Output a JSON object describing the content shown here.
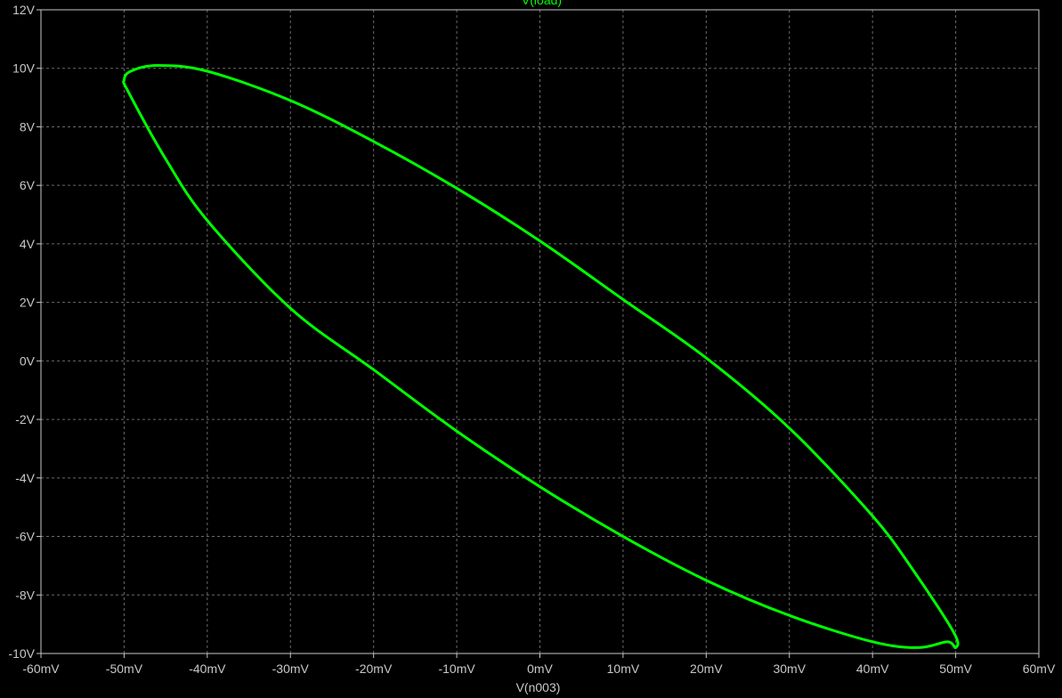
{
  "chart_data": {
    "type": "line",
    "title": "V(load)",
    "xlabel": "V(n003)",
    "ylabel": "",
    "xlim": [
      -60,
      60
    ],
    "ylim": [
      -10,
      12
    ],
    "x_unit": "mV",
    "y_unit": "V",
    "x_ticks": [
      -60,
      -50,
      -40,
      -30,
      -20,
      -10,
      0,
      10,
      20,
      30,
      40,
      50,
      60
    ],
    "y_ticks": [
      -10,
      -8,
      -6,
      -4,
      -2,
      0,
      2,
      4,
      6,
      8,
      10,
      12
    ],
    "x_tick_labels": [
      "-60mV",
      "-50mV",
      "-40mV",
      "-30mV",
      "-20mV",
      "-10mV",
      "0mV",
      "10mV",
      "20mV",
      "30mV",
      "40mV",
      "50mV",
      "60mV"
    ],
    "y_tick_labels": [
      "-10V",
      "-8V",
      "-6V",
      "-4V",
      "-2V",
      "0V",
      "2V",
      "4V",
      "6V",
      "8V",
      "10V",
      "12V"
    ],
    "grid": true,
    "colors": {
      "background": "#000000",
      "series": "#00ff00",
      "title": "#00ff00",
      "axis_text": "#c8c8c8",
      "grid": "#6a6a6a",
      "frame": "#c8c8c8"
    },
    "series": [
      {
        "name": "V(load)",
        "closed": true,
        "x": [
          -46,
          -40,
          -30,
          -20,
          -10,
          0,
          10,
          20,
          30,
          40,
          45,
          49.8,
          50,
          49,
          45.5,
          40,
          30,
          20,
          10,
          0,
          -10,
          -20,
          -30,
          -40,
          -45,
          -49.5,
          -50,
          -49.2,
          -46
        ],
        "y": [
          10.1,
          9.9,
          8.9,
          7.5,
          5.9,
          4.1,
          2.1,
          0.1,
          -2.3,
          -5.3,
          -7.2,
          -9.3,
          -9.8,
          -9.6,
          -9.8,
          -9.6,
          -8.7,
          -7.5,
          -6,
          -4.3,
          -2.4,
          -0.3,
          1.8,
          4.8,
          6.9,
          9.2,
          9.6,
          9.9,
          10.1
        ]
      }
    ]
  }
}
